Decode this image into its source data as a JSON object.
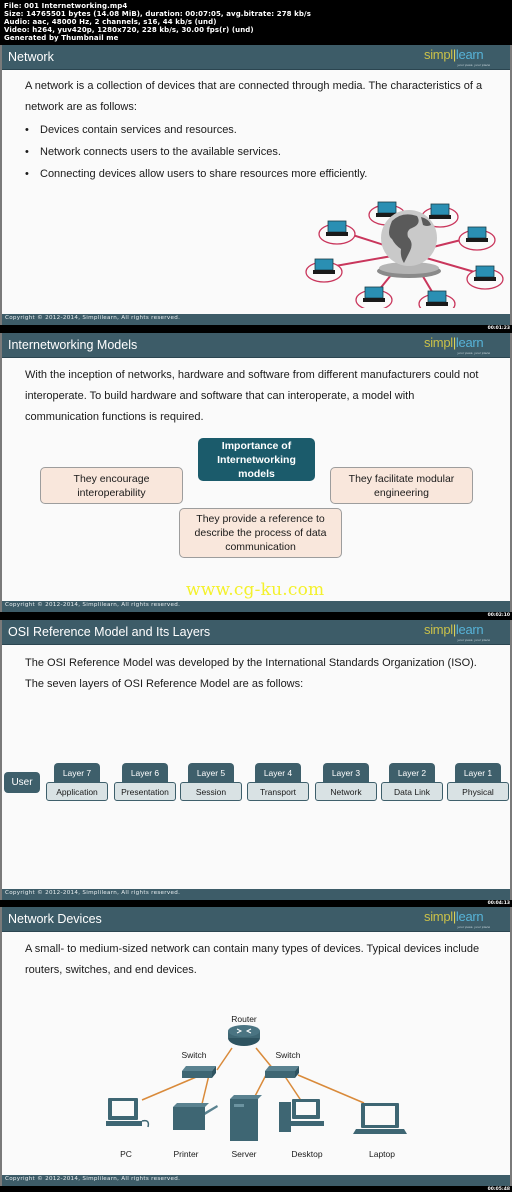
{
  "file_info": {
    "file": "File: 001 Internetworking.mp4",
    "size": "Size: 14765501 bytes (14.08 MiB), duration: 00:07:05, avg.bitrate: 278 kb/s",
    "audio": "Audio: aac, 48000 Hz, 2 channels, s16, 44 kb/s (und)",
    "video": "Video: h264, yuv420p, 1280x720, 228 kb/s, 30.00 fps(r) (und)",
    "generator": "Generated by Thumbnail me"
  },
  "brand": {
    "logo_part1": "simpl",
    "logo_bar": "i",
    "logo_part2": "learn",
    "tagline": "your pace. your place",
    "copyright": "Copyright © 2012-2014, Simplilearn, All rights reserved.",
    "header_color": "#3d5c68",
    "accent_dark": "#1b5b6b"
  },
  "watermark": "www.cg-ku.com",
  "slides": [
    {
      "title": "Network",
      "timestamp": "00:01:23",
      "intro": "A network is a collection of devices that are connected through media. The characteristics of a network are as follows:",
      "bullets": [
        "Devices contain services and resources.",
        "Network connects users to the available services.",
        "Connecting devices allow users to share resources more efficiently."
      ],
      "diagram": {
        "center": "globe",
        "nodes": 8,
        "node_type": "laptop",
        "link_color": "#c9365c"
      }
    },
    {
      "title": "Internetworking Models",
      "timestamp": "00:02:10",
      "intro": "With the inception of networks, hardware and software from different manufacturers could not interoperate. To build hardware and software that can interoperate, a model with communication functions is required.",
      "center_box": "Importance of Internetworking models",
      "boxes": [
        "They encourage interoperability",
        "They facilitate modular engineering",
        "They provide a reference to describe the process of data communication"
      ]
    },
    {
      "title": "OSI Reference Model and Its Layers",
      "timestamp": "00:04:13",
      "intro": "The OSI Reference Model was developed by the International Standards Organization (ISO). The seven layers of OSI Reference Model are as follows:",
      "user_label": "User",
      "layers": [
        {
          "number": "Layer 7",
          "name": "Application"
        },
        {
          "number": "Layer 6",
          "name": "Presentation"
        },
        {
          "number": "Layer 5",
          "name": "Session"
        },
        {
          "number": "Layer 4",
          "name": "Transport"
        },
        {
          "number": "Layer 3",
          "name": "Network"
        },
        {
          "number": "Layer 2",
          "name": "Data Link"
        },
        {
          "number": "Layer 1",
          "name": "Physical"
        }
      ]
    },
    {
      "title": "Network Devices",
      "timestamp": "00:05:48",
      "intro": "A small- to medium-sized network can contain many types of devices. Typical devices include routers, switches, and end devices.",
      "router_label": "Router",
      "switch_labels": [
        "Switch",
        "Switch"
      ],
      "end_devices": [
        "PC",
        "Printer",
        "Server",
        "Desktop",
        "Laptop"
      ],
      "link_color": "#d98a3a",
      "device_color": "#3e6673"
    }
  ]
}
